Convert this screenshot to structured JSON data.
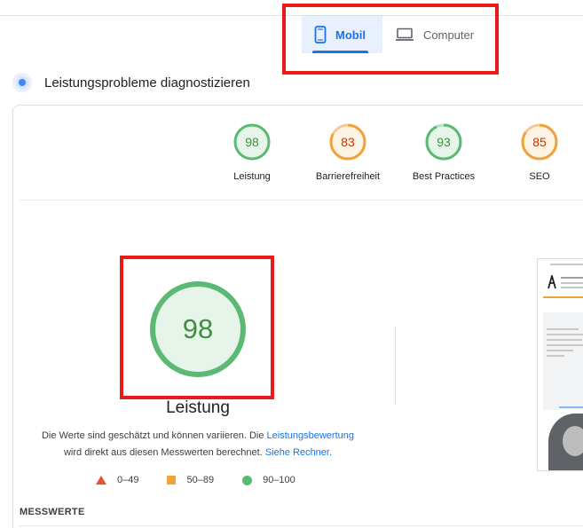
{
  "device_tabs": [
    {
      "label": "Mobil",
      "icon": "smartphone-icon",
      "active": true
    },
    {
      "label": "Computer",
      "icon": "laptop-icon",
      "active": false
    }
  ],
  "section": {
    "title": "Leistungsprobleme diagnostizieren",
    "icon": "diagnostics-icon"
  },
  "scores": [
    {
      "value": "98",
      "label": "Leistung",
      "status": "pass"
    },
    {
      "value": "83",
      "label": "Barrierefreiheit",
      "status": "average"
    },
    {
      "value": "93",
      "label": "Best Practices",
      "status": "pass"
    },
    {
      "value": "85",
      "label": "SEO",
      "status": "average"
    }
  ],
  "main_score": {
    "value": "98",
    "label": "Leistung"
  },
  "note": {
    "text_1": "Die Werte sind geschätzt und können variieren. Die ",
    "link_1": "Leistungsbewertung",
    "text_2": "wird direkt aus diesen Messwerten berechnet. ",
    "link_2": "Siehe Rechner."
  },
  "legend": [
    {
      "range": "0–49",
      "shape": "triangle",
      "color": "#e8532a"
    },
    {
      "range": "50–89",
      "shape": "square",
      "color": "#f0a33a"
    },
    {
      "range": "90–100",
      "shape": "circle",
      "color": "#5bb974"
    }
  ],
  "metrics_title": "MESSWERTE",
  "colors": {
    "pass": "#0cce6b",
    "pass_text": "#3f8f3f",
    "average": "#f0a33a",
    "average_text": "#c33300",
    "accent": "#1a73e8",
    "highlight": "#e81a1a"
  }
}
